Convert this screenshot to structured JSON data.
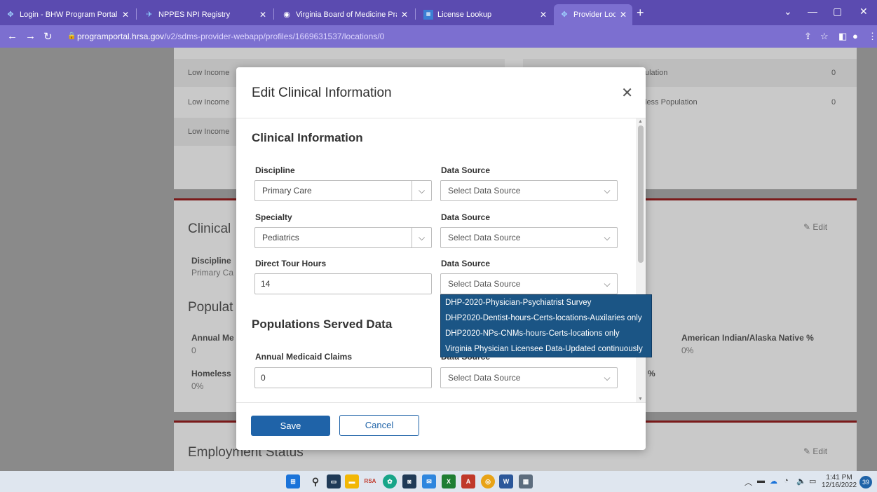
{
  "browser": {
    "tabs": [
      {
        "title": "Login - BHW Program Portal",
        "icon": "hrsa-icon"
      },
      {
        "title": "NPPES NPI Registry",
        "icon": "plane-icon"
      },
      {
        "title": "Virginia Board of Medicine Practi",
        "icon": "globe-icon"
      },
      {
        "title": "License Lookup",
        "icon": "dhp-icon"
      },
      {
        "title": "Provider Location",
        "icon": "hrsa-icon"
      }
    ],
    "url_host": "programportal.hrsa.gov",
    "url_path": "/v2/sdms-provider-webapp/profiles/1669631537/locations/0"
  },
  "background": {
    "rows": [
      "Low Income",
      "Low Income",
      "Low Income"
    ],
    "right_rows": [
      {
        "label": "ulation",
        "value": "0"
      },
      {
        "label": "less Population",
        "value": "0"
      }
    ],
    "clinical_heading": "Clinical",
    "discipline_label": "Discipline",
    "discipline_value": "Primary Ca",
    "populations_heading": "Populat",
    "annual_label": "Annual Me",
    "annual_value": "0",
    "homeless_label": "Homeless",
    "homeless_value": "0%",
    "american_indian_label": "American Indian/Alaska Native %",
    "american_indian_value": "0%",
    "percent_label": "%",
    "edit_label": "Edit",
    "employment_heading": "Employment Status"
  },
  "modal": {
    "title": "Edit Clinical Information",
    "clinical_section": "Clinical Information",
    "discipline": {
      "label": "Discipline",
      "value": "Primary Care"
    },
    "discipline_source": {
      "label": "Data Source",
      "placeholder": "Select Data Source"
    },
    "specialty": {
      "label": "Specialty",
      "value": "Pediatrics"
    },
    "specialty_source": {
      "label": "Data Source",
      "placeholder": "Select Data Source"
    },
    "direct_hours": {
      "label": "Direct Tour Hours",
      "value": "14"
    },
    "hours_source": {
      "label": "Data Source",
      "placeholder": "Select Data Source"
    },
    "populations_section": "Populations Served Data",
    "medicaid": {
      "label": "Annual Medicaid Claims",
      "value": "0"
    },
    "medicaid_source": {
      "label": "Data Source",
      "placeholder": "Select Data Source"
    },
    "dropdown_options": [
      "DHP-2020-Physician-Psychiatrist Survey",
      "DHP2020-Dentist-hours-Certs-locations-Auxilaries only",
      "DHP2020-NPs-CNMs-hours-Certs-locations only",
      "Virginia Physician Licensee Data-Updated continuously"
    ],
    "save_label": "Save",
    "cancel_label": "Cancel"
  },
  "taskbar": {
    "time": "1:41 PM",
    "date": "12/16/2022",
    "notifications": "39"
  }
}
